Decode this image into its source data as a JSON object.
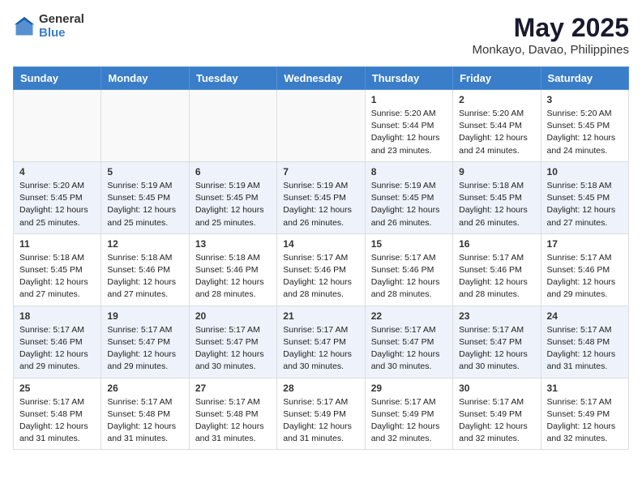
{
  "logo": {
    "general": "General",
    "blue": "Blue"
  },
  "title": "May 2025",
  "subtitle": "Monkayo, Davao, Philippines",
  "days_of_week": [
    "Sunday",
    "Monday",
    "Tuesday",
    "Wednesday",
    "Thursday",
    "Friday",
    "Saturday"
  ],
  "weeks": [
    [
      {
        "day": "",
        "info": ""
      },
      {
        "day": "",
        "info": ""
      },
      {
        "day": "",
        "info": ""
      },
      {
        "day": "",
        "info": ""
      },
      {
        "day": "1",
        "info": "Sunrise: 5:20 AM\nSunset: 5:44 PM\nDaylight: 12 hours\nand 23 minutes."
      },
      {
        "day": "2",
        "info": "Sunrise: 5:20 AM\nSunset: 5:44 PM\nDaylight: 12 hours\nand 24 minutes."
      },
      {
        "day": "3",
        "info": "Sunrise: 5:20 AM\nSunset: 5:45 PM\nDaylight: 12 hours\nand 24 minutes."
      }
    ],
    [
      {
        "day": "4",
        "info": "Sunrise: 5:20 AM\nSunset: 5:45 PM\nDaylight: 12 hours\nand 25 minutes."
      },
      {
        "day": "5",
        "info": "Sunrise: 5:19 AM\nSunset: 5:45 PM\nDaylight: 12 hours\nand 25 minutes."
      },
      {
        "day": "6",
        "info": "Sunrise: 5:19 AM\nSunset: 5:45 PM\nDaylight: 12 hours\nand 25 minutes."
      },
      {
        "day": "7",
        "info": "Sunrise: 5:19 AM\nSunset: 5:45 PM\nDaylight: 12 hours\nand 26 minutes."
      },
      {
        "day": "8",
        "info": "Sunrise: 5:19 AM\nSunset: 5:45 PM\nDaylight: 12 hours\nand 26 minutes."
      },
      {
        "day": "9",
        "info": "Sunrise: 5:18 AM\nSunset: 5:45 PM\nDaylight: 12 hours\nand 26 minutes."
      },
      {
        "day": "10",
        "info": "Sunrise: 5:18 AM\nSunset: 5:45 PM\nDaylight: 12 hours\nand 27 minutes."
      }
    ],
    [
      {
        "day": "11",
        "info": "Sunrise: 5:18 AM\nSunset: 5:45 PM\nDaylight: 12 hours\nand 27 minutes."
      },
      {
        "day": "12",
        "info": "Sunrise: 5:18 AM\nSunset: 5:46 PM\nDaylight: 12 hours\nand 27 minutes."
      },
      {
        "day": "13",
        "info": "Sunrise: 5:18 AM\nSunset: 5:46 PM\nDaylight: 12 hours\nand 28 minutes."
      },
      {
        "day": "14",
        "info": "Sunrise: 5:17 AM\nSunset: 5:46 PM\nDaylight: 12 hours\nand 28 minutes."
      },
      {
        "day": "15",
        "info": "Sunrise: 5:17 AM\nSunset: 5:46 PM\nDaylight: 12 hours\nand 28 minutes."
      },
      {
        "day": "16",
        "info": "Sunrise: 5:17 AM\nSunset: 5:46 PM\nDaylight: 12 hours\nand 28 minutes."
      },
      {
        "day": "17",
        "info": "Sunrise: 5:17 AM\nSunset: 5:46 PM\nDaylight: 12 hours\nand 29 minutes."
      }
    ],
    [
      {
        "day": "18",
        "info": "Sunrise: 5:17 AM\nSunset: 5:46 PM\nDaylight: 12 hours\nand 29 minutes."
      },
      {
        "day": "19",
        "info": "Sunrise: 5:17 AM\nSunset: 5:47 PM\nDaylight: 12 hours\nand 29 minutes."
      },
      {
        "day": "20",
        "info": "Sunrise: 5:17 AM\nSunset: 5:47 PM\nDaylight: 12 hours\nand 30 minutes."
      },
      {
        "day": "21",
        "info": "Sunrise: 5:17 AM\nSunset: 5:47 PM\nDaylight: 12 hours\nand 30 minutes."
      },
      {
        "day": "22",
        "info": "Sunrise: 5:17 AM\nSunset: 5:47 PM\nDaylight: 12 hours\nand 30 minutes."
      },
      {
        "day": "23",
        "info": "Sunrise: 5:17 AM\nSunset: 5:47 PM\nDaylight: 12 hours\nand 30 minutes."
      },
      {
        "day": "24",
        "info": "Sunrise: 5:17 AM\nSunset: 5:48 PM\nDaylight: 12 hours\nand 31 minutes."
      }
    ],
    [
      {
        "day": "25",
        "info": "Sunrise: 5:17 AM\nSunset: 5:48 PM\nDaylight: 12 hours\nand 31 minutes."
      },
      {
        "day": "26",
        "info": "Sunrise: 5:17 AM\nSunset: 5:48 PM\nDaylight: 12 hours\nand 31 minutes."
      },
      {
        "day": "27",
        "info": "Sunrise: 5:17 AM\nSunset: 5:48 PM\nDaylight: 12 hours\nand 31 minutes."
      },
      {
        "day": "28",
        "info": "Sunrise: 5:17 AM\nSunset: 5:49 PM\nDaylight: 12 hours\nand 31 minutes."
      },
      {
        "day": "29",
        "info": "Sunrise: 5:17 AM\nSunset: 5:49 PM\nDaylight: 12 hours\nand 32 minutes."
      },
      {
        "day": "30",
        "info": "Sunrise: 5:17 AM\nSunset: 5:49 PM\nDaylight: 12 hours\nand 32 minutes."
      },
      {
        "day": "31",
        "info": "Sunrise: 5:17 AM\nSunset: 5:49 PM\nDaylight: 12 hours\nand 32 minutes."
      }
    ]
  ]
}
